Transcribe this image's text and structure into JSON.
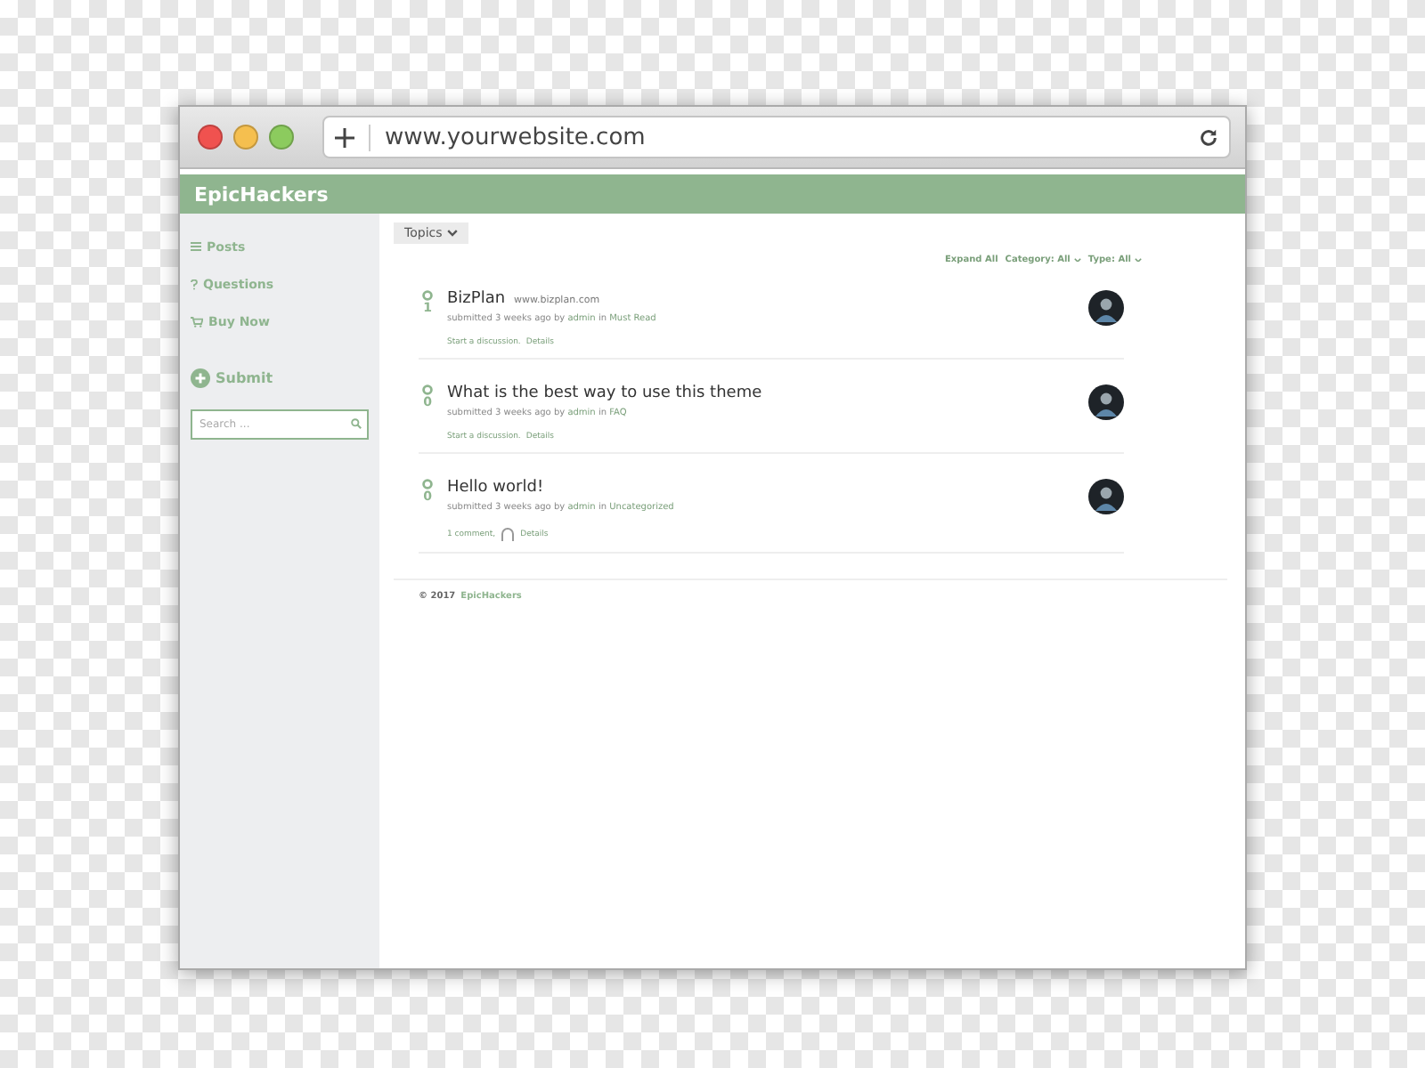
{
  "browser": {
    "url": "www.yourwebsite.com"
  },
  "header": {
    "brand": "EpicHackers"
  },
  "sidebar": {
    "items": [
      {
        "kind": "list",
        "label": "Posts"
      },
      {
        "kind": "question",
        "label": "Questions"
      },
      {
        "kind": "cart",
        "label": "Buy Now"
      }
    ],
    "submit": "Submit",
    "search": {
      "placeholder": "Search ..."
    }
  },
  "toolbar": {
    "topics": "Topics",
    "expand": "Expand All",
    "filters": [
      {
        "label": "Category: All"
      },
      {
        "label": "Type: All"
      }
    ]
  },
  "posts": [
    {
      "votes": "1",
      "title": "BizPlan",
      "domain": "www.bizplan.com",
      "submitted": "submitted 3 weeks ago by",
      "author": "admin",
      "in": "in",
      "category": "Must Read",
      "actions": [
        {
          "kind": "link",
          "label": "Start a discussion."
        },
        {
          "kind": "link",
          "label": "Details"
        }
      ]
    },
    {
      "votes": "0",
      "title": "What is the best way to use this theme",
      "submitted": "submitted 3 weeks ago by",
      "author": "admin",
      "in": "in",
      "category": "FAQ",
      "actions": [
        {
          "kind": "link",
          "label": "Start a discussion."
        },
        {
          "kind": "link",
          "label": "Details"
        }
      ]
    },
    {
      "votes": "0",
      "title": "Hello world!",
      "submitted": "submitted 3 weeks ago by",
      "author": "admin",
      "in": "in",
      "category": "Uncategorized",
      "actions": [
        {
          "kind": "link",
          "label": "1 comment,"
        },
        {
          "kind": "avatar"
        },
        {
          "kind": "link",
          "label": "Details"
        }
      ]
    }
  ],
  "footer": {
    "copyright": "© 2017",
    "brand": "EpicHackers"
  }
}
